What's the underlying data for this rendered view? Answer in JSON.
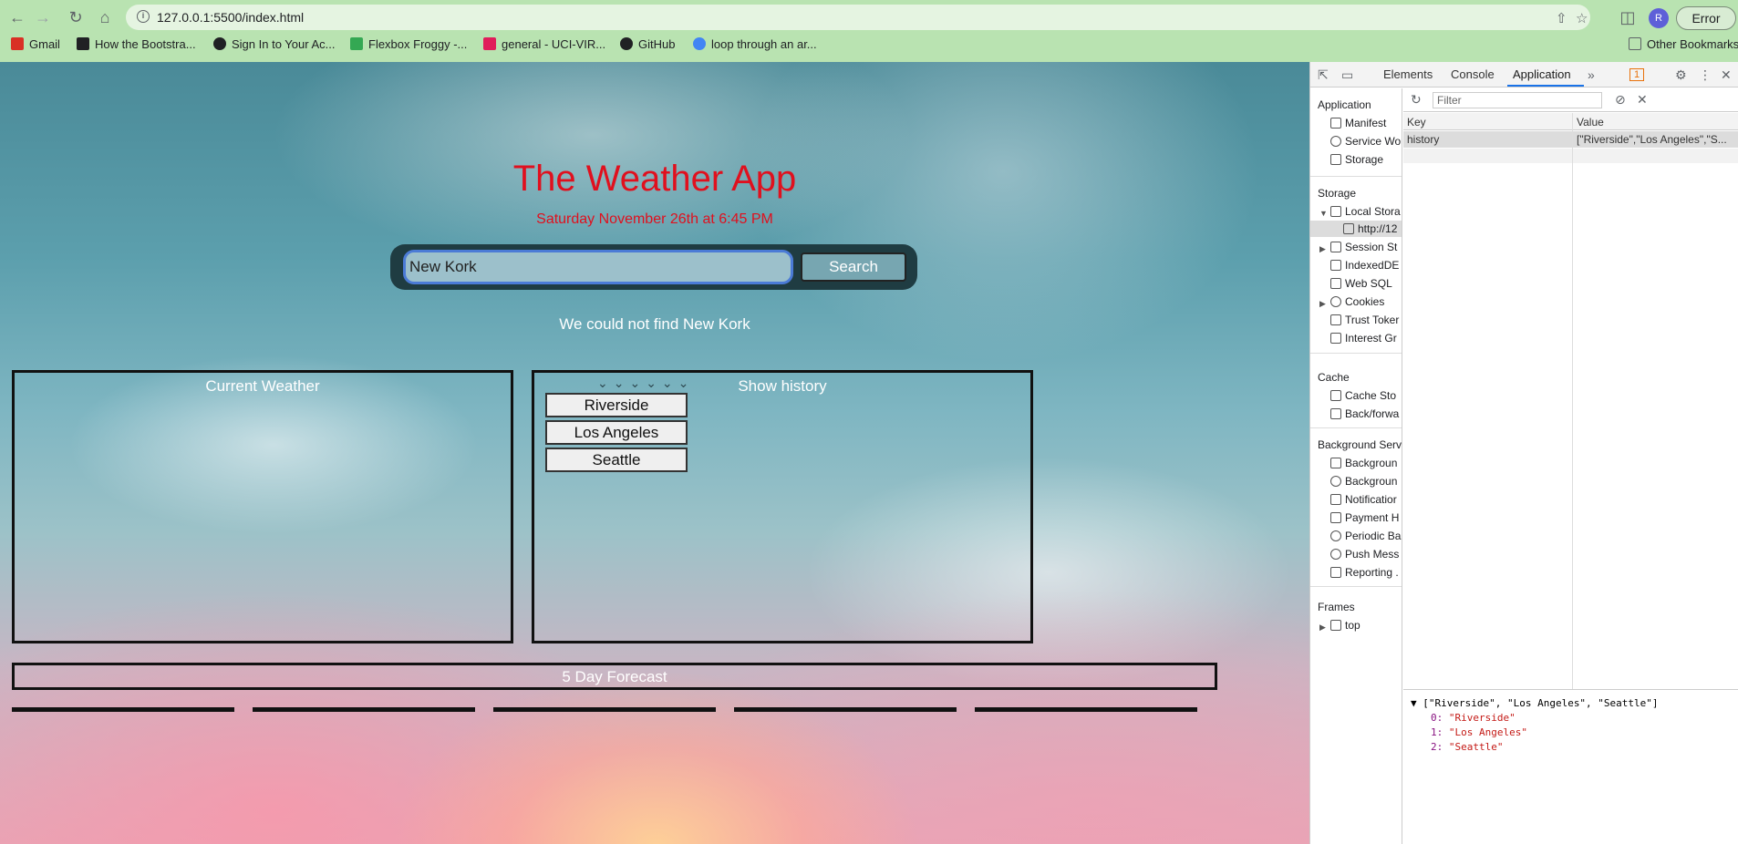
{
  "browser": {
    "url": "127.0.0.1:5500/index.html",
    "profile_initial": "R",
    "error_label": "Error",
    "bookmarks": [
      {
        "label": "Gmail",
        "color": "#d93025"
      },
      {
        "label": "How the Bootstra...",
        "color": "#202124"
      },
      {
        "label": "Sign In to Your Ac...",
        "color": "#202124"
      },
      {
        "label": "Flexbox Froggy -...",
        "color": "#34a853"
      },
      {
        "label": "general - UCI-VIR...",
        "color": "#e01e5a"
      },
      {
        "label": "GitHub",
        "color": "#202124"
      },
      {
        "label": "loop through an ar...",
        "color": "#4285f4"
      }
    ],
    "other_bookmarks": "Other Bookmarks"
  },
  "app": {
    "title": "The Weather App",
    "date": "Saturday November 26th at 6:45 PM",
    "search_value": "New Kork",
    "search_button": "Search",
    "status_message": "We could not find New Kork",
    "current_weather_title": "Current Weather",
    "history_title": "Show history",
    "history": [
      "Riverside",
      "Los Angeles",
      "Seattle"
    ],
    "forecast_title": "5 Day Forecast",
    "title_color": "#e0101e"
  },
  "devtools": {
    "tabs": [
      "Elements",
      "Console",
      "Application"
    ],
    "issues_count": "1",
    "sidebar": {
      "application_header": "Application",
      "manifest": "Manifest",
      "service_workers": "Service Wo",
      "storage": "Storage",
      "storage_header": "Storage",
      "local_storage": "Local Stora",
      "local_storage_origin": "http://12",
      "session_storage": "Session St",
      "indexeddb": "IndexedDE",
      "websql": "Web SQL",
      "cookies": "Cookies",
      "trust_tokens": "Trust Toker",
      "interest_groups": "Interest Gr",
      "cache_header": "Cache",
      "cache_storage": "Cache Sto",
      "back_forward": "Back/forwa",
      "background_header": "Background Serv",
      "bg_fetch": "Backgroun",
      "bg_sync": "Backgroun",
      "notifications": "Notificatior",
      "payment_handler": "Payment H",
      "periodic_bg": "Periodic Ba",
      "push_messaging": "Push Mess",
      "reporting": "Reporting .",
      "frames_header": "Frames",
      "frames_top": "top"
    },
    "filter_placeholder": "Filter",
    "table": {
      "key_header": "Key",
      "value_header": "Value",
      "row_key": "history",
      "row_value": "[\"Riverside\",\"Los Angeles\",\"S..."
    },
    "preview": {
      "summary": "[\"Riverside\", \"Los Angeles\", \"Seattle\"]",
      "items": [
        {
          "index": "0:",
          "value": "\"Riverside\""
        },
        {
          "index": "1:",
          "value": "\"Los Angeles\""
        },
        {
          "index": "2:",
          "value": "\"Seattle\""
        }
      ]
    }
  }
}
